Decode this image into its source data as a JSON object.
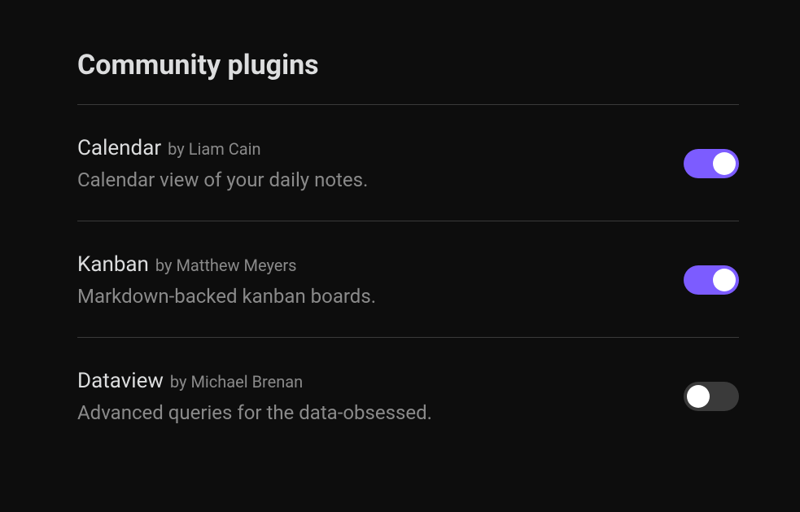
{
  "section_title": "Community plugins",
  "plugins": [
    {
      "name": "Calendar",
      "author": "by Liam Cain",
      "description": "Calendar view of your daily notes.",
      "enabled": true
    },
    {
      "name": "Kanban",
      "author": "by Matthew Meyers",
      "description": "Markdown-backed kanban boards.",
      "enabled": true
    },
    {
      "name": "Dataview",
      "author": "by Michael Brenan",
      "description": "Advanced queries for the data-obsessed.",
      "enabled": false
    }
  ]
}
